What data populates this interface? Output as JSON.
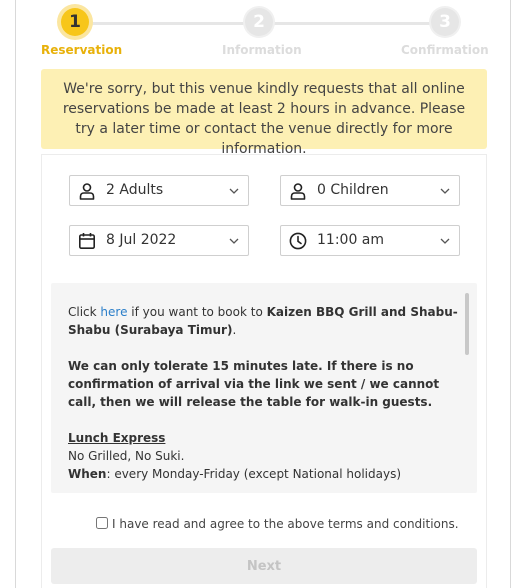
{
  "stepper": {
    "steps": [
      {
        "number": "1",
        "label": "Reservation"
      },
      {
        "number": "2",
        "label": "Information"
      },
      {
        "number": "3",
        "label": "Confirmation"
      }
    ]
  },
  "notice": {
    "text": "We're sorry, but this venue kindly requests that all online reservations be made at least 2 hours in advance. Please try a later time or contact the venue directly for more information."
  },
  "form": {
    "adults": "2 Adults",
    "children": "0 Children",
    "date": "8 Jul 2022",
    "time": "11:00 am"
  },
  "terms": {
    "click_prefix": "Click ",
    "link_text": "here",
    "click_middle": " if you want to book to ",
    "venue_name": "Kaizen BBQ Grill and Shabu-Shabu (Surabaya Timur)",
    "click_suffix": ".",
    "late_policy": "We can only tolerate 15 minutes late. If there is no confirmation of arrival via the link we sent / we cannot call, then we will release the table for walk-in guests.",
    "lunch_title": "Lunch Express",
    "lunch_desc": "No Grilled, No Suki.",
    "when_label": "When",
    "when_value": ": every Monday-Friday (except National holidays)"
  },
  "agree_label": "I have read and agree to the above terms and conditions.",
  "next_label": "Next"
}
